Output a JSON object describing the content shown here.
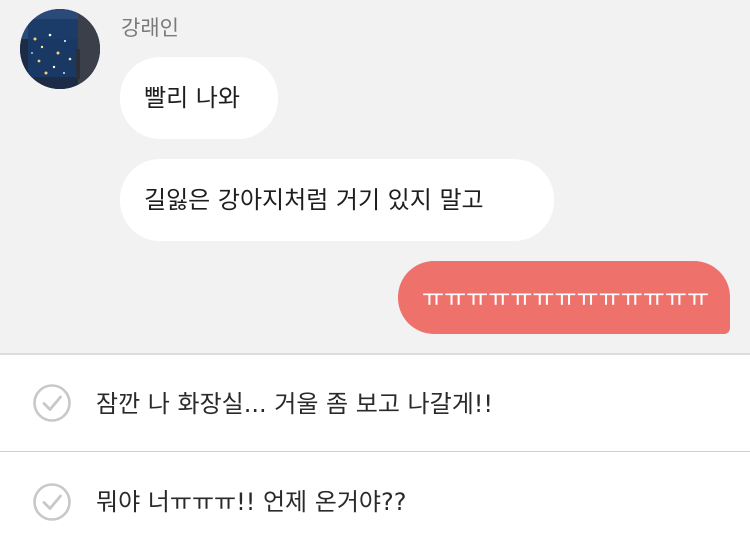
{
  "chat": {
    "sender_name": "강래인",
    "messages_in": [
      {
        "text": "빨리 나와"
      },
      {
        "text": "길잃은 강아지처럼 거기 있지 말고"
      }
    ],
    "message_out": {
      "text": "ㅠㅠㅠㅠㅠㅠㅠㅠㅠㅠㅠㅠㅠ"
    }
  },
  "choices": [
    {
      "text": "잠깐 나 화장실... 거울 좀 보고 나갈게!!",
      "icon": "check-circle-icon"
    },
    {
      "text": "뭐야 너ㅠㅠㅠ!! 언제 온거야??",
      "icon": "check-circle-icon"
    }
  ],
  "colors": {
    "chat_background": "#f2f2f2",
    "incoming_bubble": "#ffffff",
    "outgoing_bubble": "#ef716c",
    "check_icon": "#c8c8c8"
  }
}
